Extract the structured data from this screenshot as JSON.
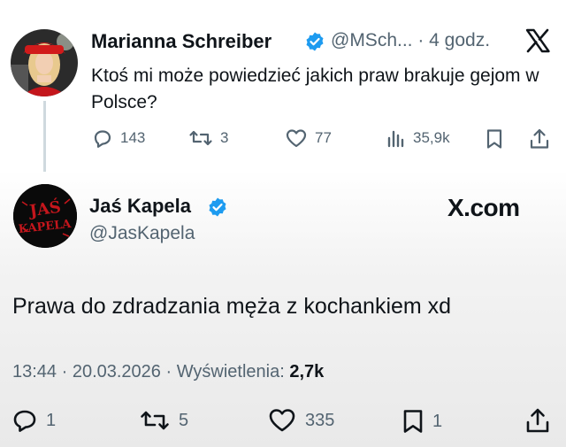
{
  "tweet1": {
    "name": "Marianna Schreiber",
    "handle_time": "@MSch... · 4 godz.",
    "text": "Ktoś mi może powiedzieć jakich praw brakuje gejom w Polsce?",
    "replies": "143",
    "retweets": "3",
    "likes": "77",
    "views": "35,9k"
  },
  "tweet2": {
    "name": "Jaś Kapela",
    "handle": "@JasKapela",
    "watermark": "X.com",
    "avatar_text": [
      "JAŚ",
      "KAPELA"
    ],
    "text": "Prawa do zdradzania męża z kochankiem xd",
    "timestamp": "13:44 · 20.03.2026 · ",
    "views_label": "Wyświetlenia: ",
    "views": "2,7k",
    "replies": "1",
    "retweets": "5",
    "likes": "335",
    "bookmarks": "1"
  },
  "colors": {
    "verified": "#1d9bf0",
    "text": "#0f1419",
    "secondary": "#536471",
    "avatar_red": "#c4161c"
  }
}
